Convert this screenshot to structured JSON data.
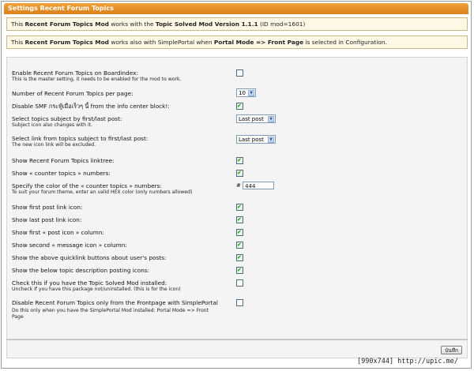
{
  "title": "Settings Recent Forum Topics",
  "info1": {
    "p1": "This ",
    "b1": "Recent Forum Topics Mod",
    "p2": " works with the ",
    "b2": "Topic Solved Mod Version 1.1.1",
    "p3": " (ID mod=1601)"
  },
  "info2": {
    "p1": "This ",
    "b1": "Recent Forum Topics Mod",
    "p2": " works also with SimplePortal when ",
    "b2": "Portal Mode => Front Page",
    "p3": " is selected in Configuration."
  },
  "settings": [
    {
      "label": "Enable Recent Forum Topics on Boardindex:",
      "sub": "This is the master setting, it needs to be enabled for the mod to work.",
      "checked": false
    },
    {
      "label": "Number of Recent Forum Topics per page:",
      "select": "10"
    },
    {
      "label": "Disable SMF กระทู้เมื่อเร็วๆ นี้ from the info center block!:",
      "checked": true
    },
    {
      "label": "Select topics subject by first/last post:",
      "sub": "Subject icon also changes with it.",
      "select": "Last post"
    },
    {
      "label": "Select link from topics subject to first/last post:",
      "sub": "The new icon link will be excluded.",
      "select": "Last post"
    },
    {
      "label": "Show Recent Forum Topics linktree:",
      "checked": true
    },
    {
      "label": "Show « counter topics » numbers:",
      "checked": true
    },
    {
      "label": "Specify the color of the « counter topics » numbers:",
      "sub": "To suit your forum theme, enter an valid HEX color (only numbers allowed)",
      "hex_prefix": "#",
      "hex_value": "444"
    },
    {
      "label": "Show first post link icon:",
      "checked": true
    },
    {
      "label": "Show last post link icon:",
      "checked": true
    },
    {
      "label": "Show first « post icon » column:",
      "checked": true
    },
    {
      "label": "Show second « message icon » column:",
      "checked": true
    },
    {
      "label": "Show the above quicklink buttons about user's posts:",
      "checked": true
    },
    {
      "label": "Show the below topic description posting icons:",
      "checked": true
    },
    {
      "label": "Check this if you have the Topic Solved Mod installed:",
      "sub": "Uncheck if you have this package not/uninstalled. (this is for the icon)",
      "checked": false
    },
    {
      "label": "Disable Recent Forum Topics only from the Frontpage with SimplePortal",
      "sub": "Do this only when you have the SimplePortal Mod installed: Portal Mode => Front Page",
      "checked": false
    }
  ],
  "save_label": "บันทึก",
  "watermark": "[990x744] http://upic.me/"
}
